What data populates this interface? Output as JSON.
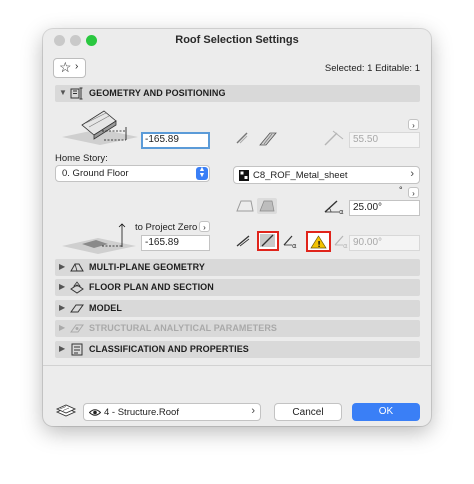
{
  "window": {
    "title": "Roof Selection Settings"
  },
  "header": {
    "selection_info": "Selected: 1 Editable: 1",
    "favorites_arrow": "›"
  },
  "sections": [
    {
      "label": "GEOMETRY AND POSITIONING",
      "expanded": true,
      "enabled": true
    },
    {
      "label": "MULTI-PLANE GEOMETRY",
      "expanded": false,
      "enabled": true
    },
    {
      "label": "FLOOR PLAN AND SECTION",
      "expanded": false,
      "enabled": true
    },
    {
      "label": "MODEL",
      "expanded": false,
      "enabled": true
    },
    {
      "label": "STRUCTURAL ANALYTICAL PARAMETERS",
      "expanded": false,
      "enabled": false
    },
    {
      "label": "CLASSIFICATION AND PROPERTIES",
      "expanded": false,
      "enabled": true
    }
  ],
  "geometry": {
    "top_offset_value": "-165.89",
    "home_story_label": "Home Story:",
    "home_story_value": "0. Ground Floor",
    "to_project_zero_label": "to Project Zero",
    "project_zero_value": "-165.89",
    "thickness_value": "55.50",
    "building_material": "C8_ROF_Metal_sheet",
    "degree_symbol": "°",
    "pitch_value": "25.00°",
    "edge_angle_value": "90.00°"
  },
  "footer": {
    "layer_value": "4 - Structure.Roof",
    "cancel_label": "Cancel",
    "ok_label": "OK"
  },
  "colors": {
    "accent": "#3a7ff6",
    "highlight_box": "#e0241b",
    "warning": "#f2c200"
  }
}
